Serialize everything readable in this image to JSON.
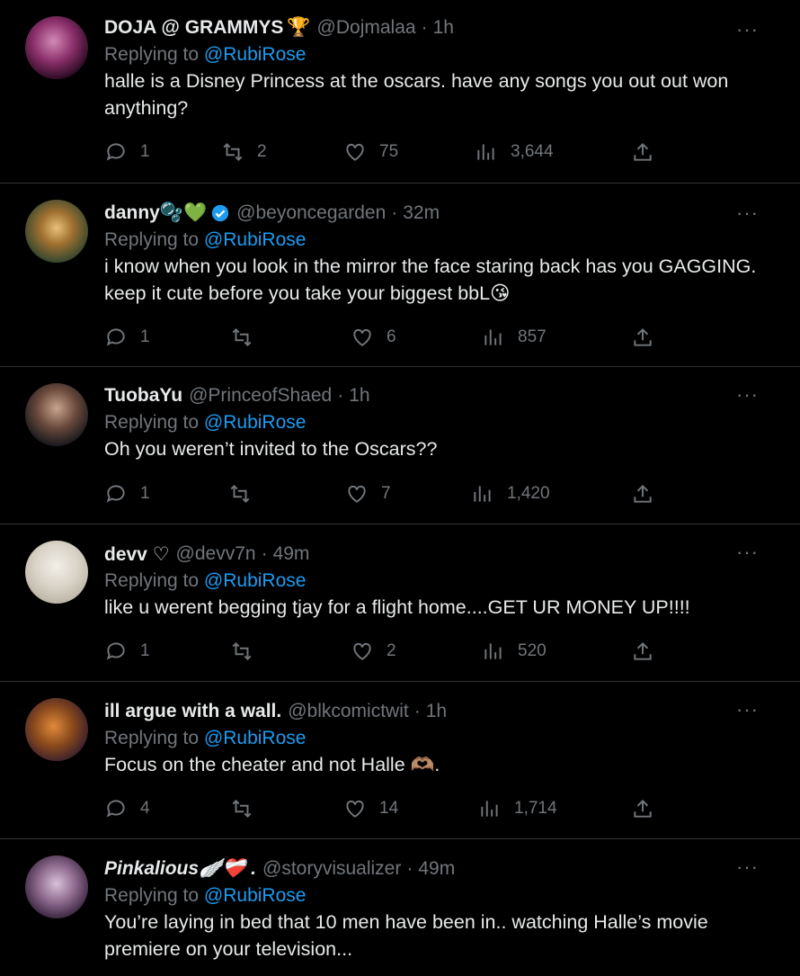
{
  "tweets": [
    {
      "name": "DOJA @ GRAMMYS",
      "name_emoji": "🏆",
      "handle": "@Dojmalaa",
      "time": "1h",
      "replying_to_label": "Replying to",
      "replying_to": "@RubiRose",
      "text": "halle is a Disney Princess at the oscars. have any songs you out out won anything?",
      "replies": "1",
      "retweets": "2",
      "likes": "75",
      "views": "3,644"
    },
    {
      "name": "danny🫧💚",
      "verified": true,
      "handle": "@beyoncegarden",
      "time": "32m",
      "replying_to_label": "Replying to",
      "replying_to": "@RubiRose",
      "text": "i know when you look in the mirror the face staring back has you GAGGING. keep it cute before you take your biggest bbL😘",
      "replies": "1",
      "retweets": "",
      "likes": "6",
      "views": "857"
    },
    {
      "name": "TuobaYu",
      "handle": "@PrinceofShaed",
      "time": "1h",
      "replying_to_label": "Replying to",
      "replying_to": "@RubiRose",
      "text": "Oh you weren’t invited to the Oscars??",
      "replies": "1",
      "retweets": "",
      "likes": "7",
      "views": "1,420"
    },
    {
      "name": "devv ♡",
      "handle": "@devv7n",
      "time": "49m",
      "replying_to_label": "Replying to",
      "replying_to": "@RubiRose",
      "text": "like u werent begging tjay for a flight home....GET UR MONEY UP!!!!",
      "replies": "1",
      "retweets": "",
      "likes": "2",
      "views": "520"
    },
    {
      "name": "ill argue with a wall.",
      "handle": "@blkcomictwit",
      "time": "1h",
      "replying_to_label": "Replying to",
      "replying_to": "@RubiRose",
      "text": "Focus on the cheater and not Halle 🫶🏽.",
      "replies": "4",
      "retweets": "",
      "likes": "14",
      "views": "1,714"
    },
    {
      "name": "Pinkalious🪽❤️‍🩹 .",
      "handle": "@storyvisualizer",
      "time": "49m",
      "replying_to_label": "Replying to",
      "replying_to": "@RubiRose",
      "text": "You’re laying in bed that 10 men have been in.. watching Halle’s movie premiere on your television..."
    }
  ],
  "ui": {
    "more_glyph": "···",
    "time_separator": "·"
  },
  "colors": {
    "background": "#000000",
    "text": "#e7e9ea",
    "muted": "#71767b",
    "mention": "#1d9bf0",
    "divider": "#2f3336"
  },
  "icons": [
    "reply-icon",
    "retweet-icon",
    "like-icon",
    "views-icon",
    "share-icon",
    "more-icon",
    "verified-badge-icon"
  ]
}
